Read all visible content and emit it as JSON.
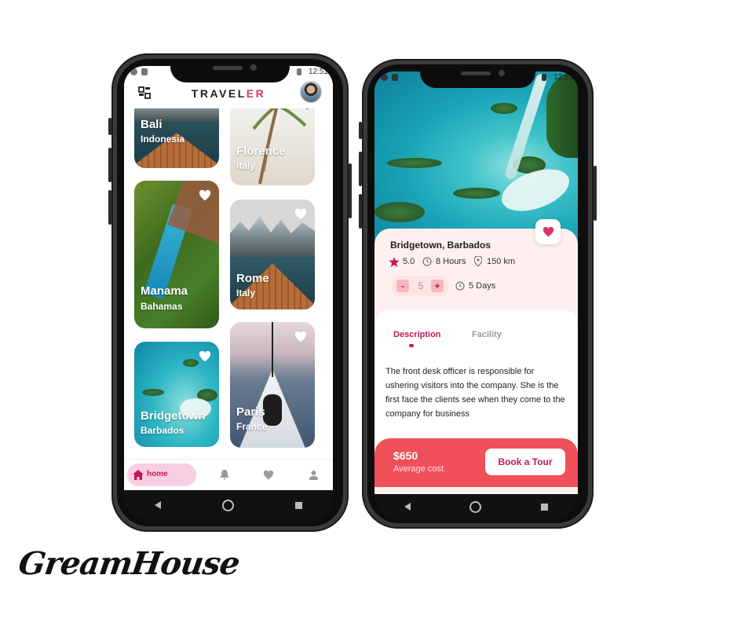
{
  "status_time": "12:51",
  "home": {
    "logo_part1": "TRAVEL",
    "logo_part2": "ER",
    "cards": [
      {
        "city": "Bali",
        "country": "Indonesia"
      },
      {
        "city": "Florence",
        "country": "Italy"
      },
      {
        "city": "Manama",
        "country": "Bahamas"
      },
      {
        "city": "Rome",
        "country": "Italy"
      },
      {
        "city": "Bridgetown",
        "country": "Barbados"
      },
      {
        "city": "Paris",
        "country": "France"
      }
    ],
    "bottom_nav": {
      "home_label": "home"
    }
  },
  "detail": {
    "title": "Bridgetown, Barbados",
    "rating": "5.0",
    "duration": "8 Hours",
    "distance": "150 km",
    "quantity": "5",
    "minus": "-",
    "plus": "+",
    "days": "5 Days",
    "tabs": [
      "Description",
      "Facility"
    ],
    "description": "The front desk officer is responsible for ushering visitors into the company. She is the first face the clients see when they come to the company for business",
    "price": "$650",
    "price_label": "Average cost",
    "book_label": "Book a Tour"
  },
  "brand": "GreamHouse",
  "colors": {
    "accent": "#d6356b",
    "book_bar": "#f0505a",
    "pill": "#f8cfe0"
  }
}
